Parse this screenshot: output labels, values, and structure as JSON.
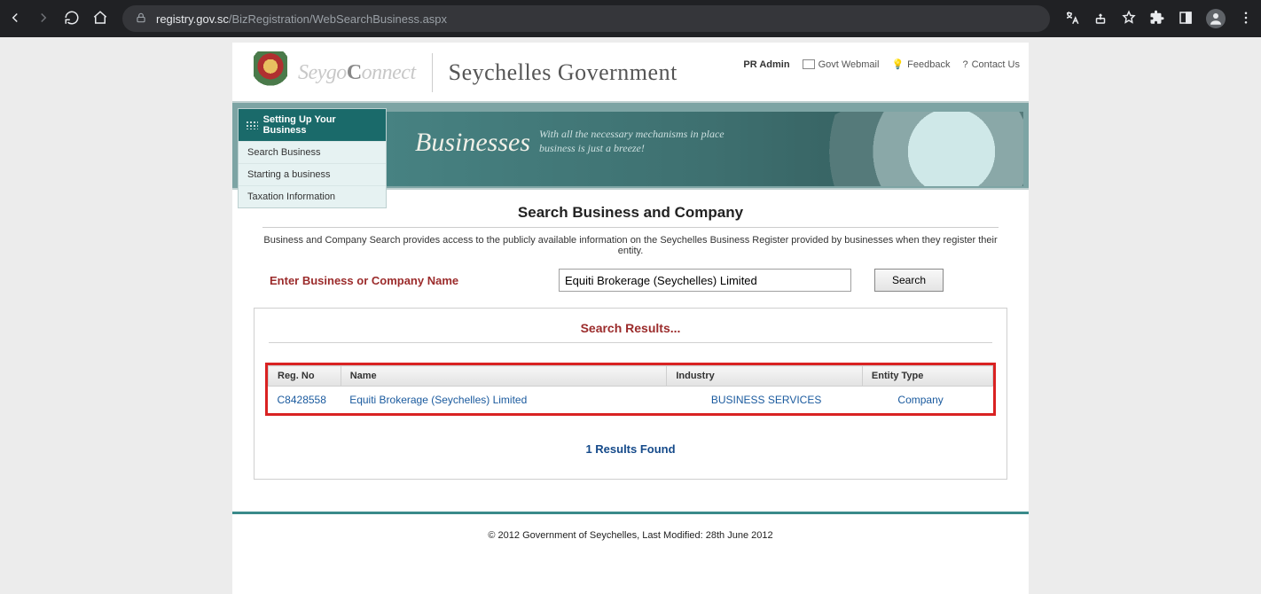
{
  "browser": {
    "url_display_prefix": "registry.gov.sc",
    "url_display_rest": "/BizRegistration/WebSearchBusiness.aspx"
  },
  "header": {
    "brand_left": "Seygo",
    "brand_right": "onnect",
    "gov_title": "Seychelles Government",
    "links": {
      "admin": "PR Admin",
      "webmail": "Govt Webmail",
      "feedback": "Feedback",
      "contact": "Contact Us"
    }
  },
  "sidebar": {
    "title": "Setting Up Your Business",
    "items": [
      {
        "label": "Search Business"
      },
      {
        "label": "Starting a business"
      },
      {
        "label": "Taxation Information"
      }
    ]
  },
  "banner": {
    "title": "Businesses",
    "subtitle_line1": "With all the necessary mechanisms in place",
    "subtitle_line2": "business is just a breeze!"
  },
  "main": {
    "page_title": "Search Business and Company",
    "intro": "Business and Company Search provides access to the publicly available information on the Seychelles Business Register provided by businesses when they register their entity.",
    "search_label": "Enter Business or Company Name",
    "search_value": "Equiti Brokerage (Seychelles) Limited",
    "search_button": "Search",
    "results": {
      "heading": "Search Results...",
      "columns": [
        "Reg. No",
        "Name",
        "Industry",
        "Entity Type"
      ],
      "rows": [
        {
          "reg_no": "C8428558",
          "name": "Equiti Brokerage (Seychelles) Limited",
          "industry": "BUSINESS SERVICES",
          "entity_type": "Company"
        }
      ],
      "found_text": "1 Results Found"
    }
  },
  "footer": {
    "text": "© 2012 Government of Seychelles, Last Modified: 28th June 2012"
  }
}
